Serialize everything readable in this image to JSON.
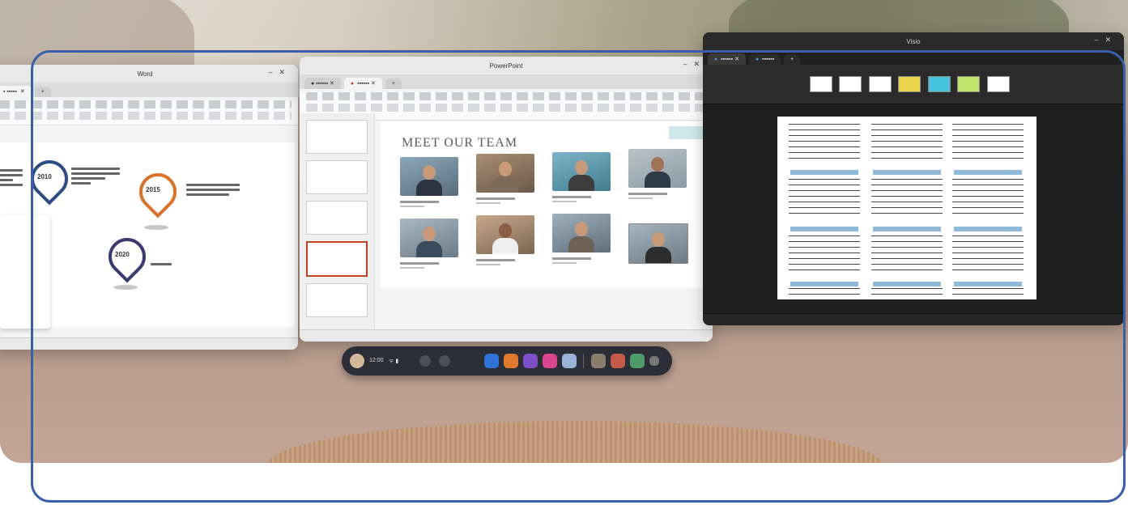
{
  "left_window": {
    "title": "Word",
    "pins": [
      {
        "label": "2010"
      },
      {
        "label": "2015"
      },
      {
        "label": "2020"
      }
    ]
  },
  "middle_window": {
    "title": "PowerPoint",
    "slide_title": "MEET OUR TEAM"
  },
  "right_window": {
    "title": "Visio"
  },
  "taskbar": {
    "time": "12:00"
  },
  "colors": {
    "focus_frame": "#3a5fa8",
    "ppt_accent": "#c44323",
    "pin_blue": "#2e4e83",
    "pin_orange": "#d8722c",
    "pin_navy": "#3b3c6e"
  }
}
